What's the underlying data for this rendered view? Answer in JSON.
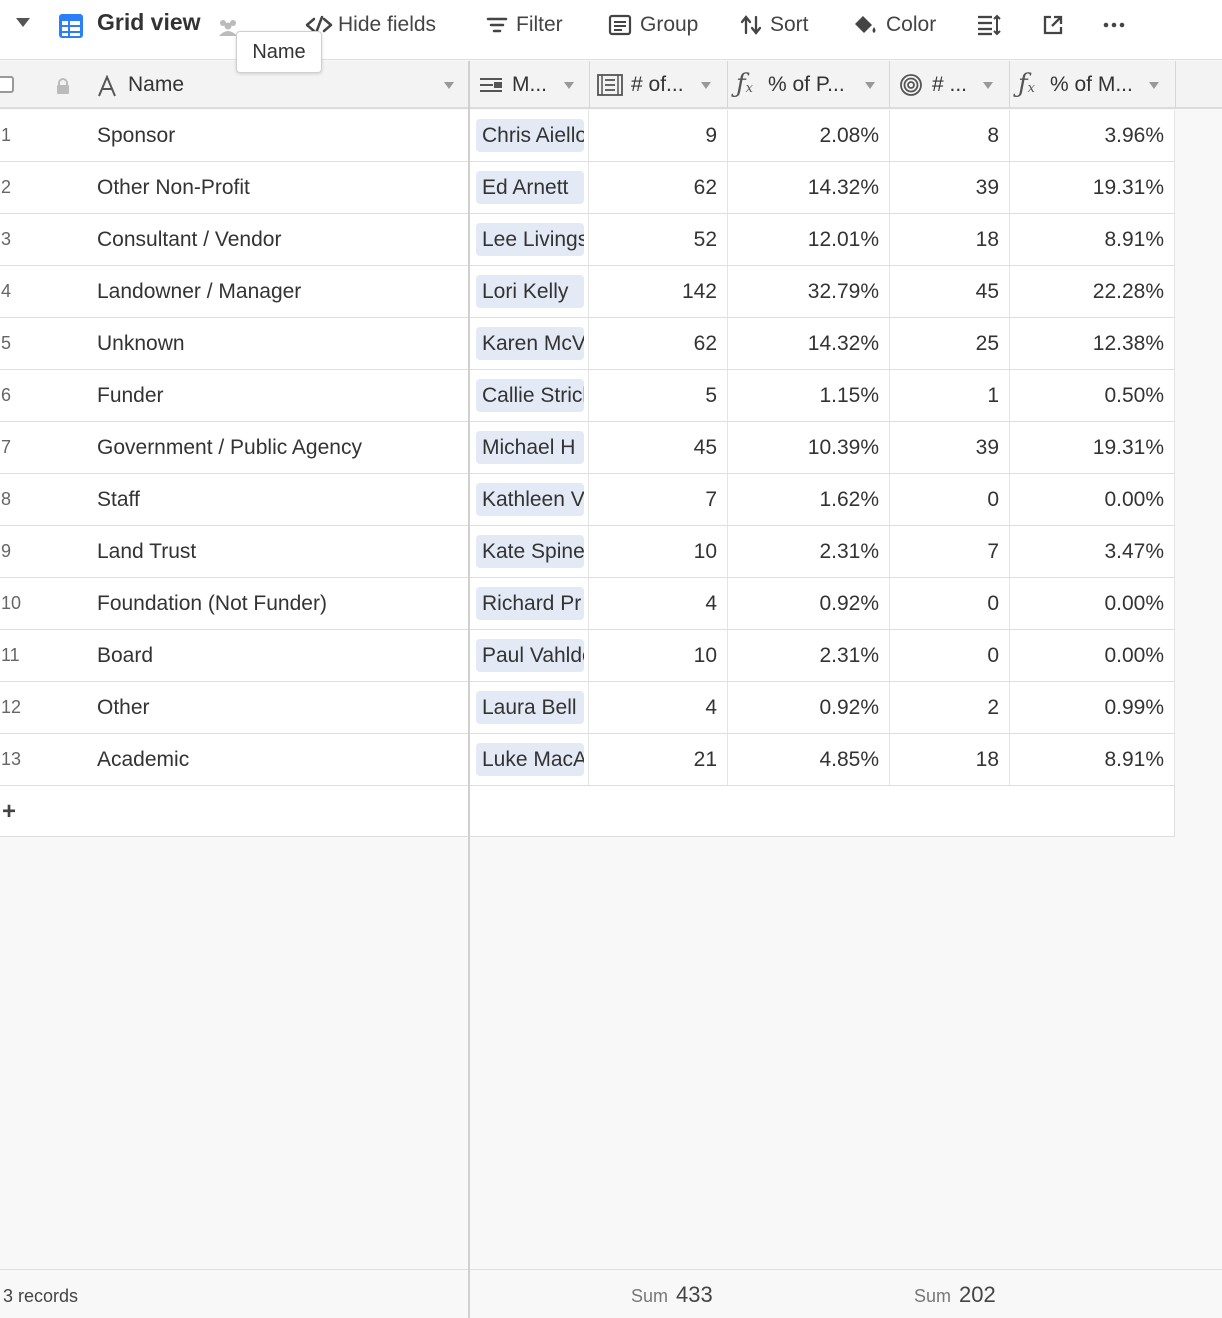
{
  "toolbar": {
    "view_name": "Grid view",
    "hide_fields": "Hide fields",
    "filter": "Filter",
    "group": "Group",
    "sort": "Sort",
    "color": "Color",
    "tooltip": "Name"
  },
  "columns": {
    "name": "Name",
    "members": "M...",
    "count_people": "# of...",
    "pct_people": "% of P...",
    "count_members": "# ...",
    "pct_members": "% of M..."
  },
  "rows": [
    {
      "num": "1",
      "name": "Sponsor",
      "link": "Chris Aiello",
      "c1": "9",
      "p1": "2.08%",
      "c2": "8",
      "p2": "3.96%"
    },
    {
      "num": "2",
      "name": "Other Non-Profit",
      "link": "Ed Arnett",
      "c1": "62",
      "p1": "14.32%",
      "c2": "39",
      "p2": "19.31%"
    },
    {
      "num": "3",
      "name": "Consultant / Vendor",
      "link": "Lee Livingston",
      "c1": "52",
      "p1": "12.01%",
      "c2": "18",
      "p2": "8.91%"
    },
    {
      "num": "4",
      "name": "Landowner / Manager",
      "link": "Lori Kelly",
      "c1": "142",
      "p1": "32.79%",
      "c2": "45",
      "p2": "22.28%"
    },
    {
      "num": "5",
      "name": "Unknown",
      "link": "Karen McV",
      "c1": "62",
      "p1": "14.32%",
      "c2": "25",
      "p2": "12.38%"
    },
    {
      "num": "6",
      "name": "Funder",
      "link": "Callie Strick",
      "c1": "5",
      "p1": "1.15%",
      "c2": "1",
      "p2": "0.50%"
    },
    {
      "num": "7",
      "name": "Government / Public Agency",
      "link": "Michael H",
      "c1": "45",
      "p1": "10.39%",
      "c2": "39",
      "p2": "19.31%"
    },
    {
      "num": "8",
      "name": "Staff",
      "link": "Kathleen V",
      "c1": "7",
      "p1": "1.62%",
      "c2": "0",
      "p2": "0.00%"
    },
    {
      "num": "9",
      "name": "Land Trust",
      "link": "Kate Spine",
      "c1": "10",
      "p1": "2.31%",
      "c2": "7",
      "p2": "3.47%"
    },
    {
      "num": "10",
      "name": "Foundation (Not Funder)",
      "link": "Richard Pr",
      "c1": "4",
      "p1": "0.92%",
      "c2": "0",
      "p2": "0.00%"
    },
    {
      "num": "11",
      "name": "Board",
      "link": "Paul Vahlde",
      "c1": "10",
      "p1": "2.31%",
      "c2": "0",
      "p2": "0.00%"
    },
    {
      "num": "12",
      "name": "Other",
      "link": "Laura Bell",
      "c1": "4",
      "p1": "0.92%",
      "c2": "2",
      "p2": "0.99%"
    },
    {
      "num": "13",
      "name": "Academic",
      "link": "Luke MacA",
      "c1": "21",
      "p1": "4.85%",
      "c2": "18",
      "p2": "8.91%"
    }
  ],
  "footer": {
    "records": "3 records",
    "sum_label": "Sum",
    "sum_people": "433",
    "sum_members": "202"
  },
  "colors": {
    "accent_blue": "#2d7ff9",
    "chip_bg": "#e3e9f5"
  }
}
